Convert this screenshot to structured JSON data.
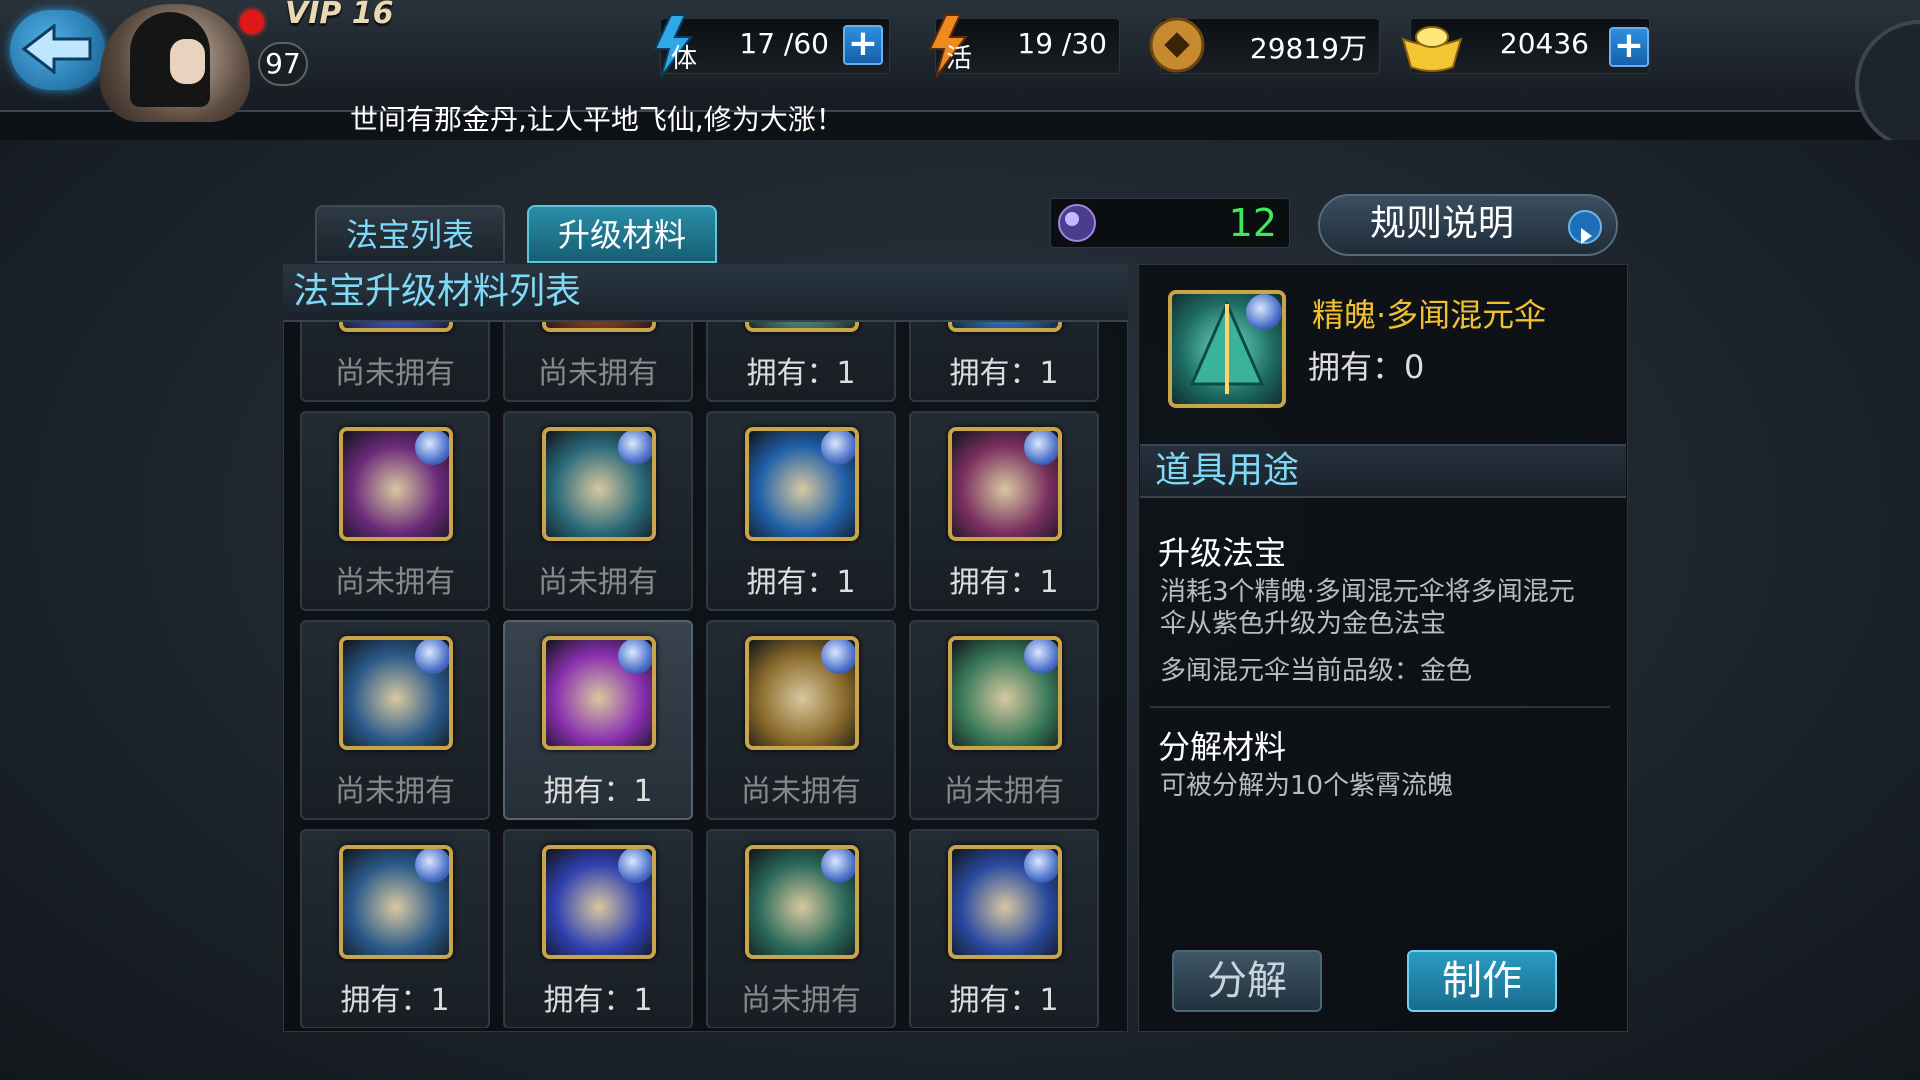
{
  "header": {
    "vip": "VIP 16",
    "level": "97",
    "stamina": {
      "label": "体",
      "value": "17 /60"
    },
    "vigor": {
      "label": "活",
      "value": "19 /30"
    },
    "coins": {
      "value": "29819万"
    },
    "gold": {
      "value": "20436"
    },
    "marquee": "世间有那金丹,让人平地飞仙,修为大涨！"
  },
  "tabs": [
    {
      "label": "法宝列表",
      "active": false
    },
    {
      "label": "升级材料",
      "active": true
    }
  ],
  "counter": {
    "value": "12"
  },
  "rules_button": "规则说明",
  "list": {
    "title": "法宝升级材料列表",
    "items": [
      {
        "label": "尚未拥有",
        "owned": false
      },
      {
        "label": "尚未拥有",
        "owned": false
      },
      {
        "label": "拥有：1",
        "owned": true
      },
      {
        "label": "拥有：1",
        "owned": true
      },
      {
        "label": "尚未拥有",
        "owned": false
      },
      {
        "label": "尚未拥有",
        "owned": false
      },
      {
        "label": "拥有：1",
        "owned": true
      },
      {
        "label": "拥有：1",
        "owned": true
      },
      {
        "label": "尚未拥有",
        "owned": false
      },
      {
        "label": "拥有：1",
        "owned": true
      },
      {
        "label": "尚未拥有",
        "owned": false
      },
      {
        "label": "尚未拥有",
        "owned": false
      },
      {
        "label": "拥有：1",
        "owned": true
      },
      {
        "label": "拥有：1",
        "owned": true
      },
      {
        "label": "尚未拥有",
        "owned": false
      },
      {
        "label": "拥有：1",
        "owned": true
      }
    ]
  },
  "detail": {
    "name": "精魄·多闻混元伞",
    "own": "拥有：0",
    "use_title": "道具用途",
    "section1_title": "升级法宝",
    "section1_text": "消耗3个精魄·多闻混元伞将多闻混元伞从紫色升级为金色法宝",
    "section1_grade": "多闻混元伞当前品级：金色",
    "section2_title": "分解材料",
    "section2_text": "可被分解为10个紫霄流魄",
    "btn_decompose": "分解",
    "btn_make": "制作"
  },
  "colors": {
    "accent": "#7fd8f5",
    "gold_text": "#f0c030",
    "green_count": "#3de85a",
    "icon_border": "#c8a44b"
  }
}
